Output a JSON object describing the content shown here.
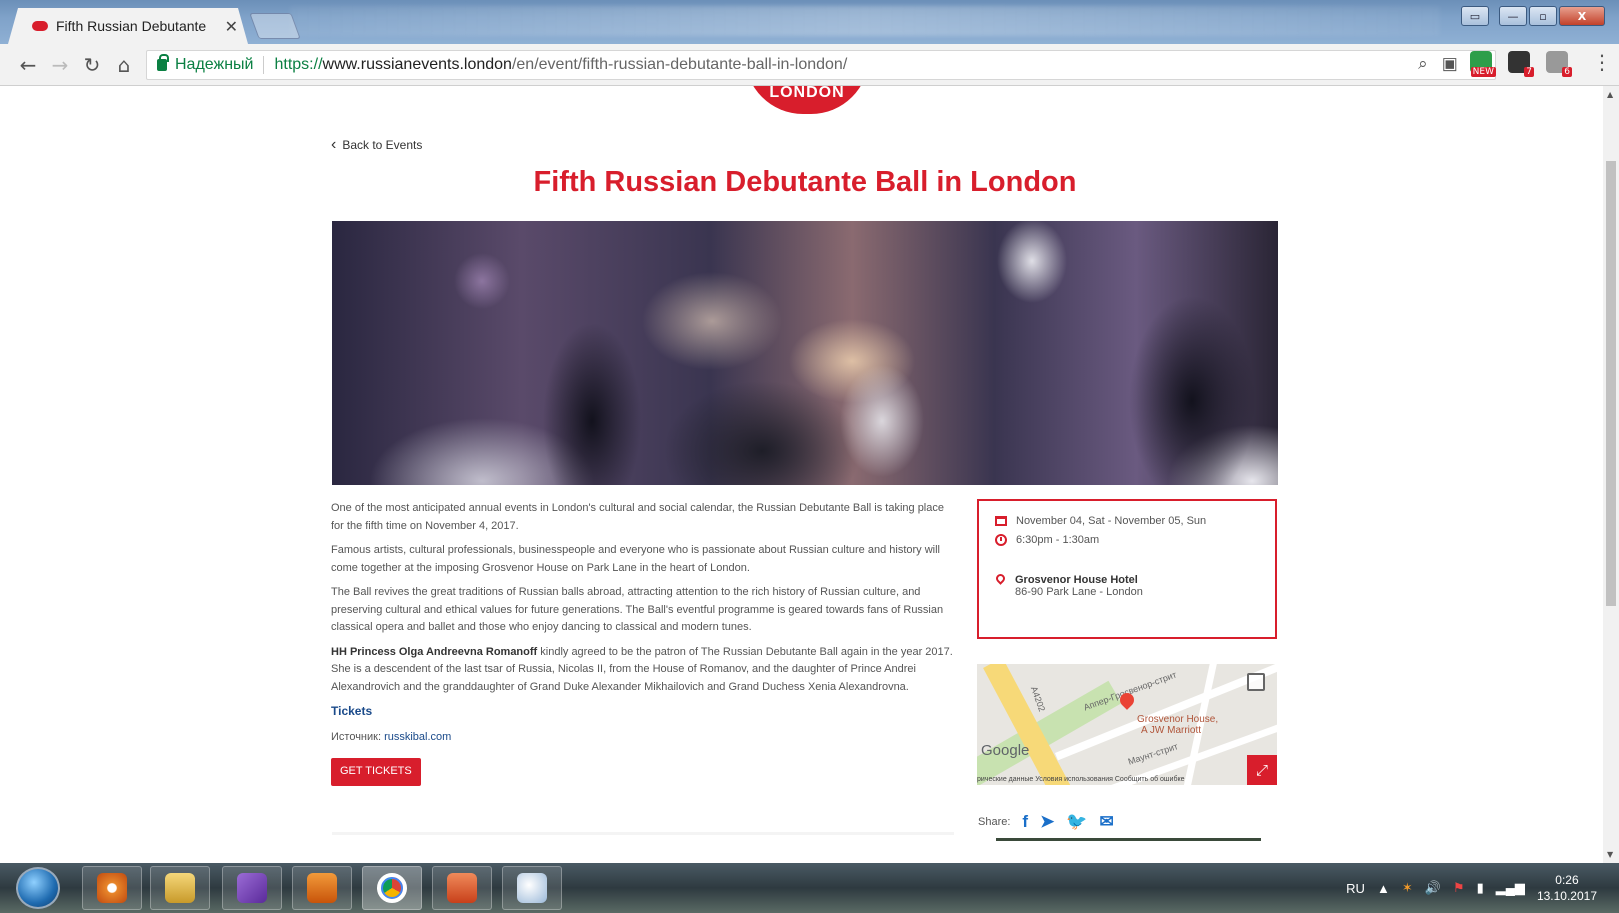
{
  "browser": {
    "tab_title": "Fifth Russian Debutante",
    "tab_close": "✕",
    "secure_label": "Надежный",
    "url_scheme": "https://",
    "url_host": "www.russianevents.london",
    "url_path": "/en/event/fifth-russian-debutante-ball-in-london/",
    "ext_badges": [
      "NEW",
      "7",
      "6"
    ],
    "window_buttons": [
      "▭",
      "—",
      "▫",
      "X"
    ]
  },
  "page": {
    "logo_text": "LONDON",
    "back_link": "Back to Events",
    "title": "Fifth Russian Debutante Ball in London",
    "paragraphs": [
      "One of the most anticipated annual events in London's cultural and social calendar, the Russian Debutante Ball is taking place for the fifth time on November 4, 2017.",
      "Famous artists, cultural professionals, businesspeople and everyone who is passionate about Russian culture and history will come together at the imposing Grosvenor House on Park Lane in the heart of London.",
      "The Ball revives the great traditions of Russian balls abroad, attracting attention to the rich history of Russian culture, and preserving cultural and ethical values for future generations. The Ball's eventful programme is geared towards fans of Russian classical opera and ballet and those who enjoy dancing to classical and modern tunes."
    ],
    "patron_name": "HH Princess Olga Andreevna Romanoff",
    "patron_text": " kindly agreed to be the patron of The Russian Debutante Ball again in the year 2017. She is a descendent of the last tsar of Russia, Nicolas II, from the House of Romanov, and the daughter of Prince Andrei Alexandrovich and the granddaughter of Grand Duke Alexander Mikhailovich and Grand Duchess Xenia Alexandrovna.",
    "tickets_label": "Tickets",
    "source_label": "Источник: ",
    "source_link": "russkibal.com",
    "get_tickets": "GET TICKETS",
    "dates": "November 04, Sat - November 05, Sun",
    "time": "6:30pm - 1:30am",
    "venue_name": "Grosvenor House Hotel",
    "venue_address": "86-90 Park Lane - London",
    "map": {
      "road_label": "A4202",
      "street_label": "Аппер-Гросвенор-стрит",
      "street2_label": "Маунт-стрит",
      "place_label_1": "Grosvenor House,",
      "place_label_2": "A JW Marriott",
      "google": "Google",
      "footer": "рические данные Условия использования Сообщить об ошибке"
    },
    "share_label": "Share:"
  },
  "taskbar": {
    "lang": "RU",
    "time": "0:26",
    "date": "13.10.2017"
  }
}
